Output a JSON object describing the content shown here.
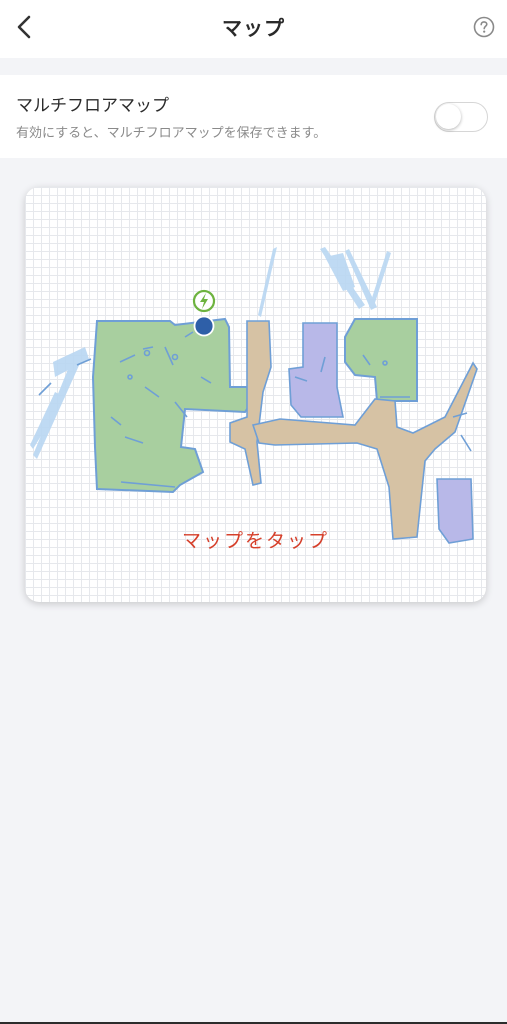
{
  "header": {
    "title": "マップ",
    "back_icon": "chevron-left-icon",
    "help_icon": "question-circle-icon"
  },
  "multi_floor": {
    "title": "マルチフロアマップ",
    "description": "有効にすると、マルチフロアマップを保存できます。",
    "enabled": false
  },
  "map": {
    "tap_label": "マップをタップ",
    "dock_icon": "lightning-icon",
    "robot_icon": "robot-position-icon",
    "colors": {
      "green_room": "#a8cf9f",
      "tan_room": "#d6c2a4",
      "purple_room": "#b8b8e8",
      "wall": "#6f9fd6",
      "scan": "#b9d7f2",
      "dock": "#6db33f",
      "robot": "#2e5fa8",
      "tap_label": "#d6402b"
    }
  }
}
